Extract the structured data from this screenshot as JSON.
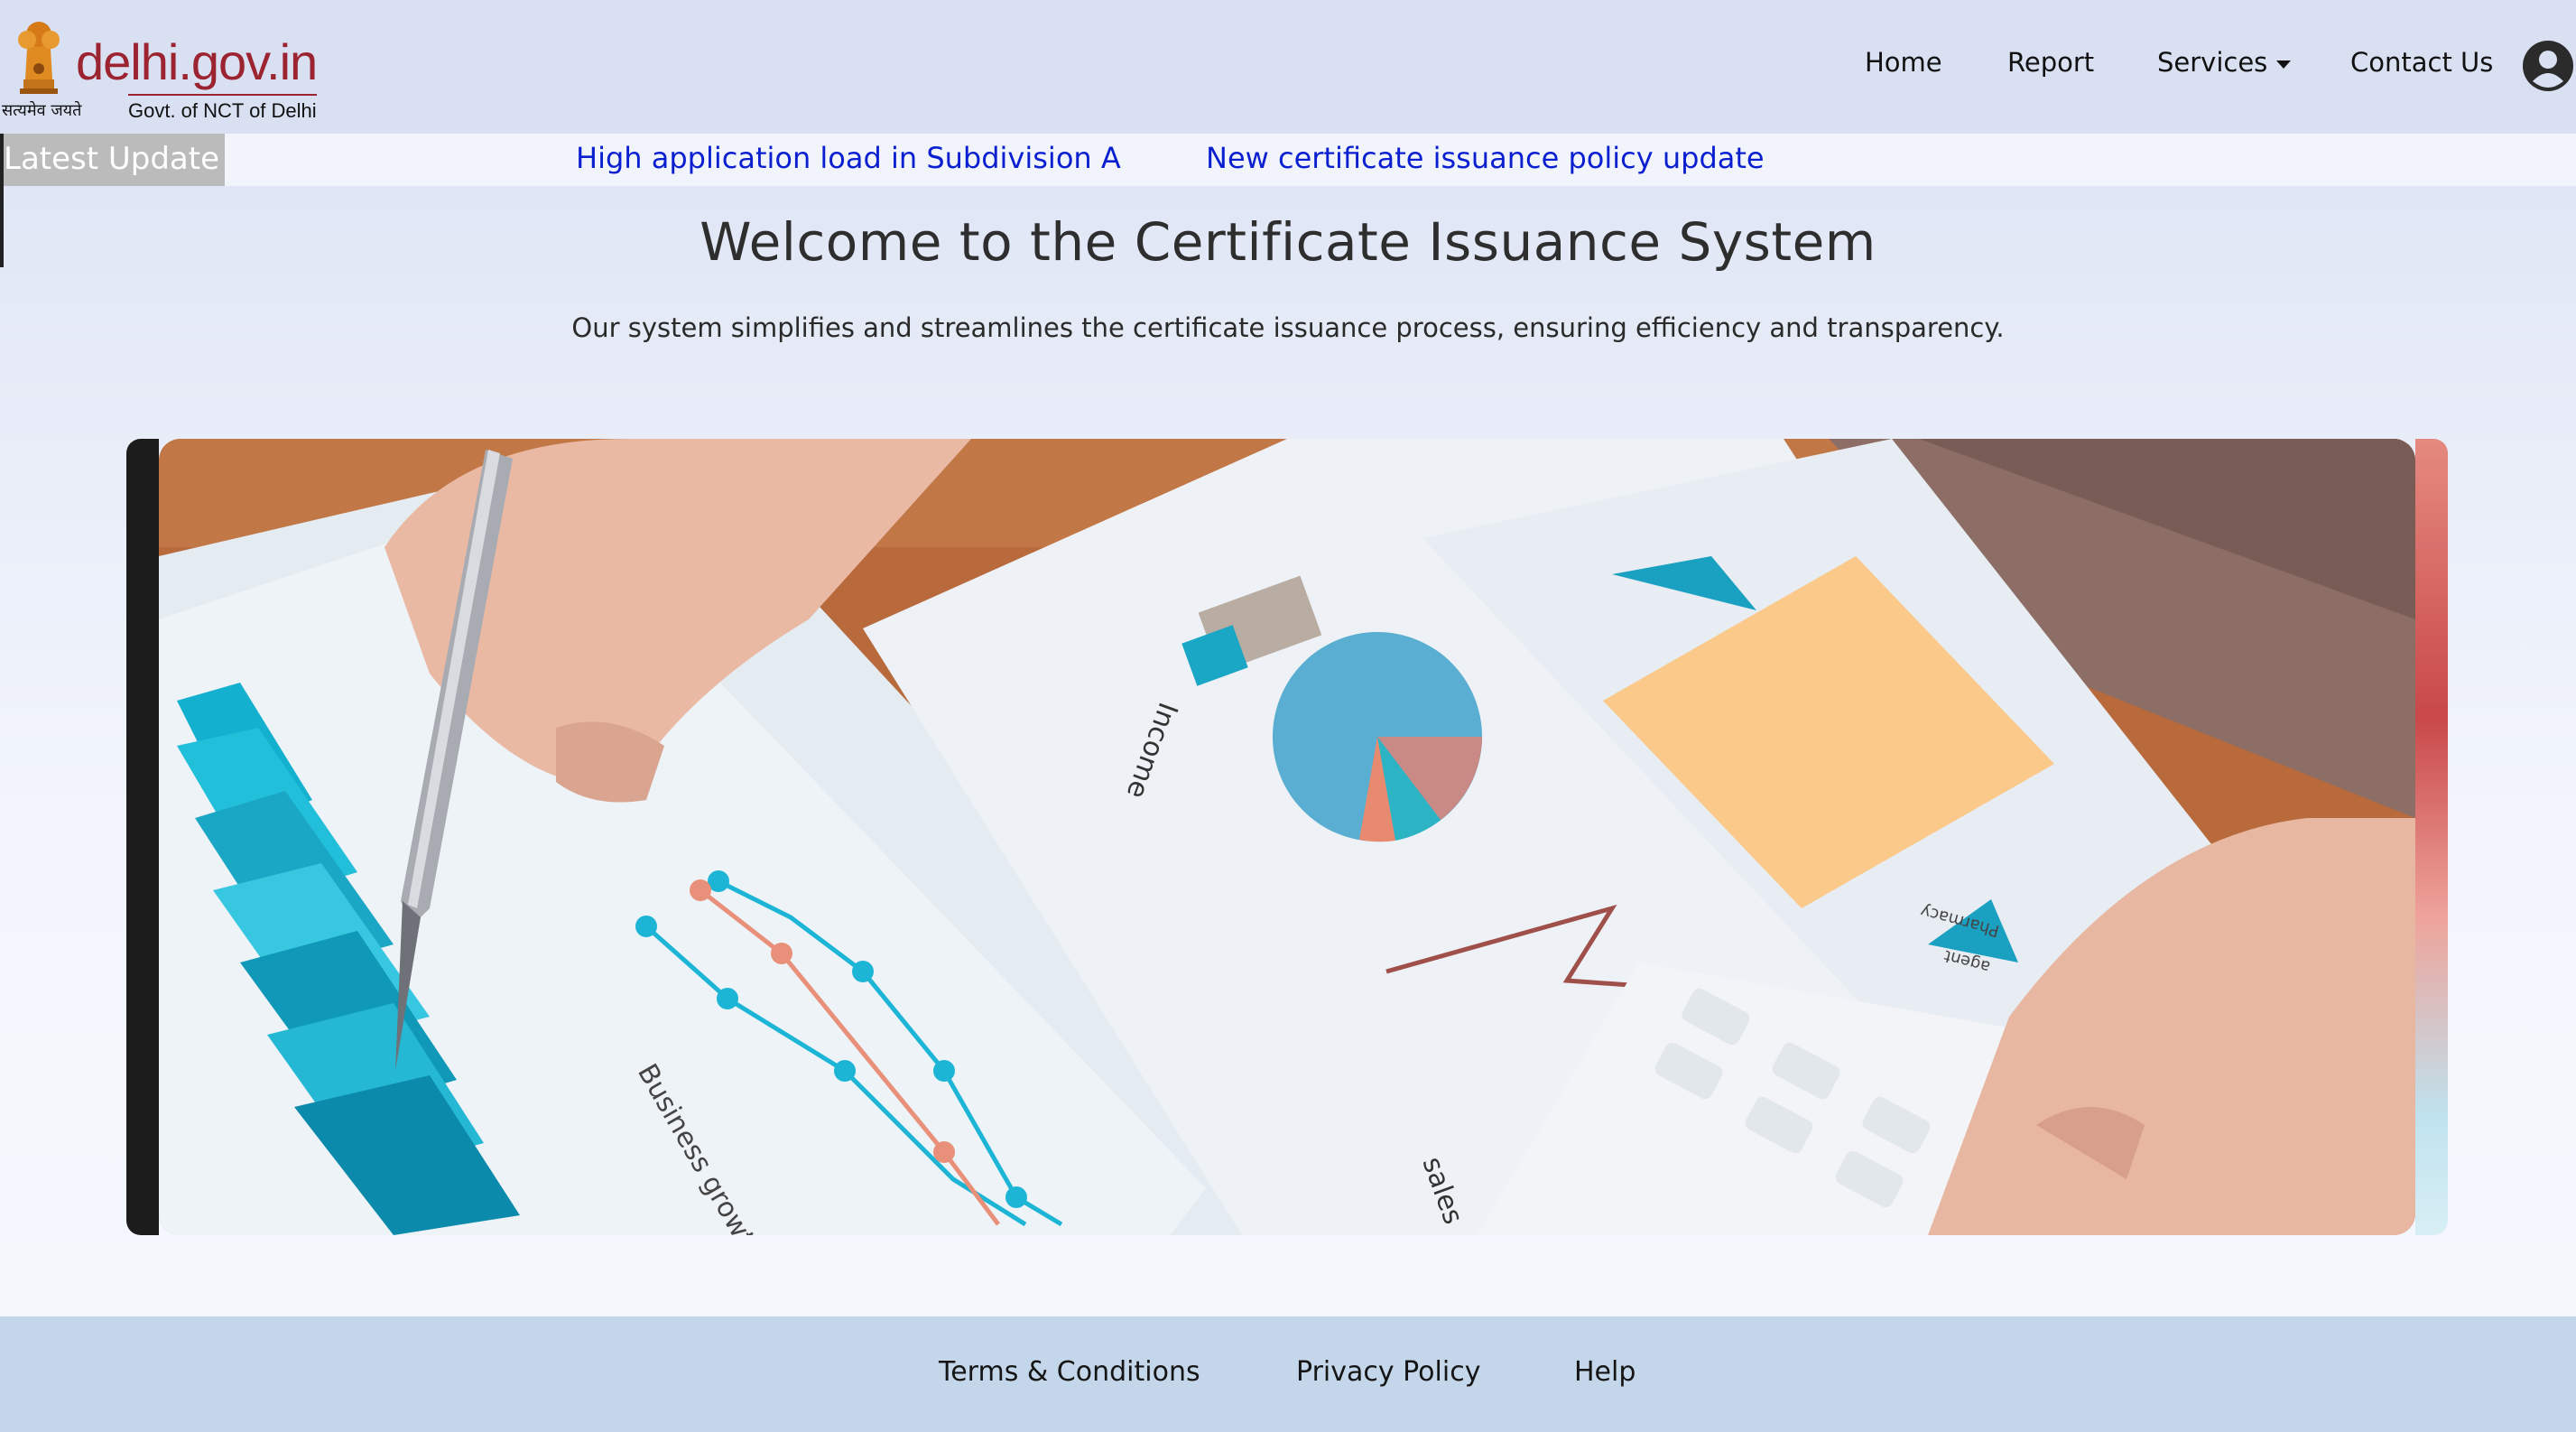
{
  "brand": {
    "site_name": "delhi.gov.in",
    "motto": "सत्यमेव जयते",
    "subtitle": "Govt. of NCT of Delhi"
  },
  "nav": {
    "items": [
      {
        "label": "Home"
      },
      {
        "label": "Report"
      },
      {
        "label": "Services"
      },
      {
        "label": "Contact Us"
      }
    ]
  },
  "ticker": {
    "label": "Latest Update",
    "items": [
      "High application load in Subdivision A",
      "New certificate issuance policy update"
    ]
  },
  "hero": {
    "title": "Welcome to the Certificate Issuance System",
    "description": "Our system simplifies and streamlines the certificate issuance process, ensuring efficiency and transparency."
  },
  "carousel": {
    "photo_labels": [
      "Income",
      "Business growth",
      "sales",
      "Pharmacy",
      "agent"
    ]
  },
  "footer": {
    "links": [
      "Terms & Conditions",
      "Privacy Policy",
      "Help"
    ]
  },
  "colors": {
    "header_bg": "#d8e0f2",
    "brand_red": "#9c2330",
    "ticker_link": "#0a1fd0",
    "footer_bg": "#c4d6ea",
    "teal": "#17a9c7"
  }
}
